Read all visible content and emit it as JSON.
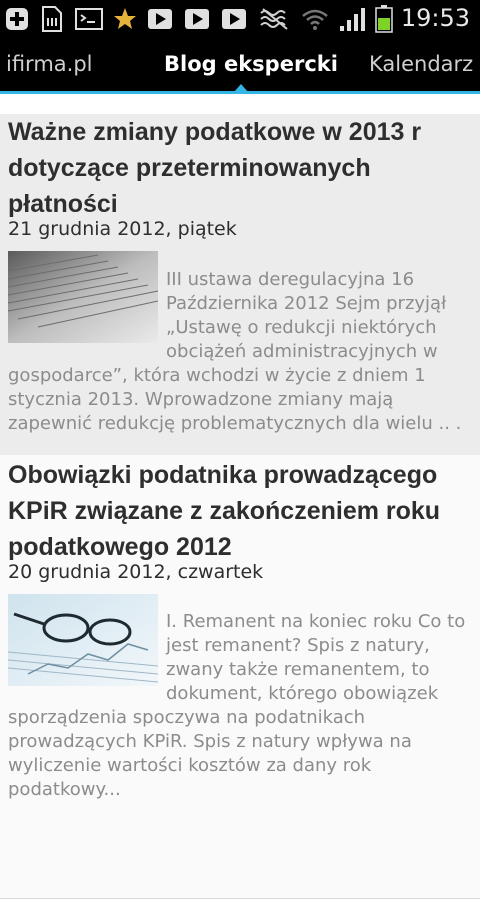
{
  "status_bar": {
    "time": "19:53",
    "icons": [
      "plus-icon",
      "sd-card-icon",
      "terminal-icon",
      "star-icon",
      "play-store-icon",
      "play-store-icon",
      "play-store-icon",
      "no-signal-icon",
      "wifi-icon",
      "signal-icon",
      "battery-icon"
    ]
  },
  "tabs": {
    "left": "ifirma.pl",
    "active": "Blog ekspercki",
    "right": "Kalendarz"
  },
  "posts": [
    {
      "title": "Ważne zmiany podatkowe w 2013 r dotyczące przeterminowanych płatności",
      "date": "21 grudnia 2012, piątek",
      "excerpt": "III ustawa deregulacyjna 16 Października 2012 Sejm przyjął „Ustawę o redukcji niektórych obciążeń administracyjnych w gospodarce”, która wchodzi w życie z dniem 1 stycznia 2013. Wprowadzone zmiany mają zapewnić redukcję problematycznych dla wielu .. ."
    },
    {
      "title": "Obowiązki podatnika prowadzącego KPiR związane z zakończeniem roku podatkowego 2012",
      "date": "20 grudnia 2012, czwartek",
      "excerpt": "I. Remanent na koniec roku Co to jest remanent? Spis z natury, zwany także remanentem, to dokument, którego obowiązek sporządzenia spoczywa na podatnikach prowadzących KPiR. Spis z natury wpływa na wyliczenie wartości kosztów za dany rok podatkowy..."
    }
  ],
  "colors": {
    "accent": "#33b5e5",
    "status_bar_bg": "#000000",
    "item_bg": "#ececec",
    "battery": "#7fd127"
  }
}
